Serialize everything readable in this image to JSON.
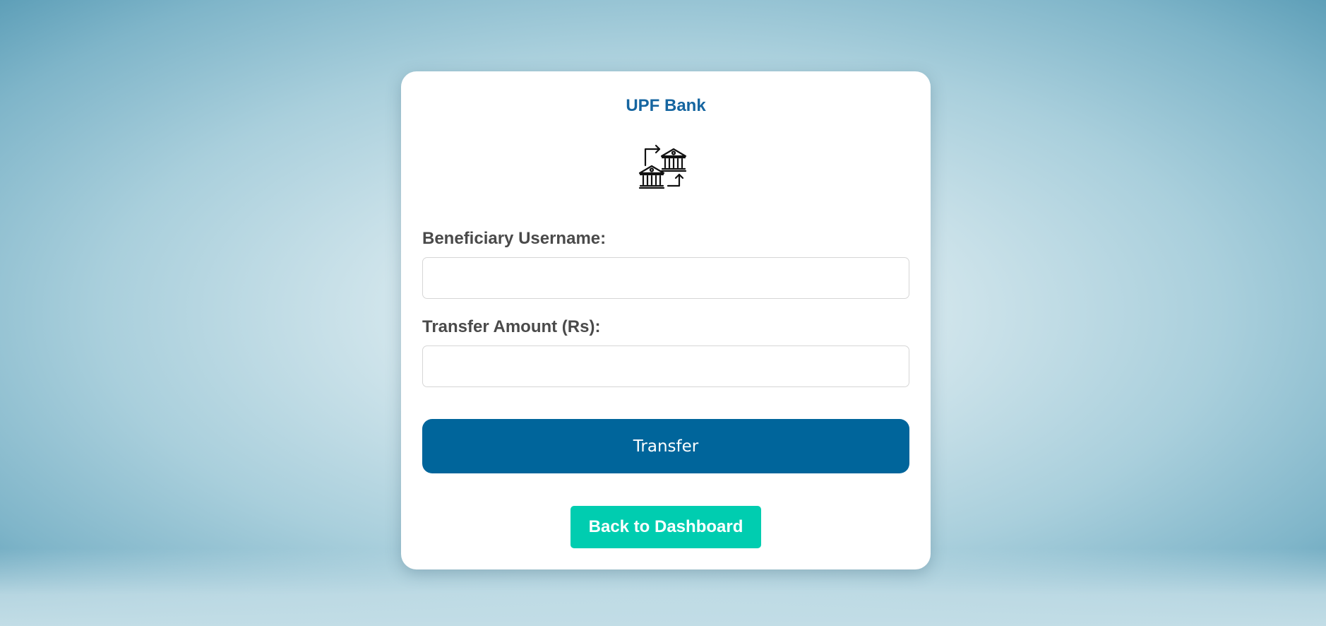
{
  "app": {
    "title": "UPF Bank",
    "logo_icon": "bank-transfer-icon",
    "brand_color": "#1565a0"
  },
  "form": {
    "beneficiary_label": "Beneficiary Username:",
    "beneficiary_value": "",
    "amount_label": "Transfer Amount (Rs):",
    "amount_value": "",
    "submit_label": "Transfer",
    "submit_color": "#00659b"
  },
  "nav": {
    "back_label": "Back to Dashboard",
    "back_color": "#00cdb0"
  }
}
